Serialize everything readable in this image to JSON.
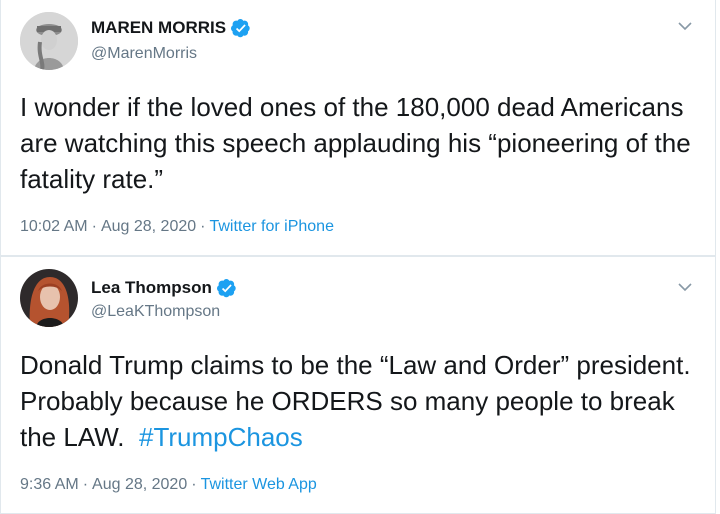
{
  "tweets": [
    {
      "display_name": "MAREN MORRIS",
      "handle": "@MarenMorris",
      "text": "I wonder if the loved ones of the 180,000 dead Americans are watching this speech applauding his “pioneering of the fatality rate.”",
      "time": "10:02 AM",
      "date": "Aug 28, 2020",
      "source": "Twitter for iPhone",
      "verified_icon": "verified-badge-icon",
      "menu_icon": "chevron-down-icon"
    },
    {
      "display_name": "Lea Thompson",
      "handle": "@LeaKThompson",
      "text_main": "Donald Trump claims to be the “Law and Order” president.  Probably because he ORDERS so many people to break the LAW.",
      "hashtag": "#TrumpChaos",
      "time": "9:36 AM",
      "date": "Aug 28, 2020",
      "source": "Twitter Web App",
      "verified_icon": "verified-badge-icon",
      "menu_icon": "chevron-down-icon"
    }
  ],
  "colors": {
    "link": "#1b95e0",
    "secondary_text": "#657786",
    "verified": "#1da1f2",
    "border": "#e1e8ed"
  },
  "separators": {
    "dot": "·"
  }
}
